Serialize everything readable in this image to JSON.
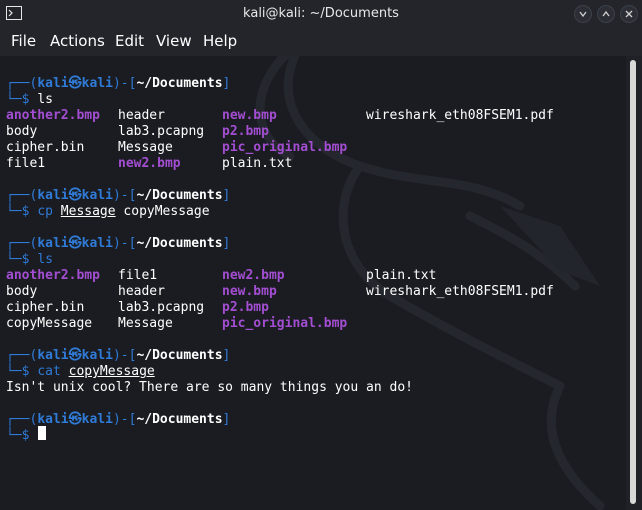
{
  "window": {
    "title": "kali@kali: ~/Documents"
  },
  "menu": [
    "File",
    "Actions",
    "Edit",
    "View",
    "Help"
  ],
  "prompt": {
    "user": "kali",
    "host": "kali",
    "path": "~/Documents"
  },
  "blocks": [
    {
      "command": "ls",
      "output": [
        [
          "another2.bmp",
          "header",
          "new.bmp",
          "wireshark_eth08FSEM1.pdf"
        ],
        [
          "body",
          "lab3.pcapng",
          "p2.bmp",
          ""
        ],
        [
          "cipher.bin",
          "Message",
          "pic_original.bmp",
          ""
        ],
        [
          "file1",
          "new2.bmp",
          "plain.txt",
          ""
        ]
      ]
    },
    {
      "command": "cp",
      "args": [
        "Message",
        "copyMessage"
      ]
    },
    {
      "command": "ls",
      "output": [
        [
          "another2.bmp",
          "file1",
          "new2.bmp",
          "plain.txt"
        ],
        [
          "body",
          "header",
          "new.bmp",
          "wireshark_eth08FSEM1.pdf"
        ],
        [
          "cipher.bin",
          "lab3.pcapng",
          "p2.bmp",
          ""
        ],
        [
          "copyMessage",
          "Message",
          "pic_original.bmp",
          ""
        ]
      ]
    },
    {
      "command": "cat",
      "args": [
        "copyMessage"
      ],
      "output_text": "Isn't unix cool? There are so many things you an do!"
    }
  ],
  "colors": {
    "prompt_blue": "#2f7bd7",
    "bmp_purple": "#a34ed2",
    "background": "#1a1c21"
  }
}
